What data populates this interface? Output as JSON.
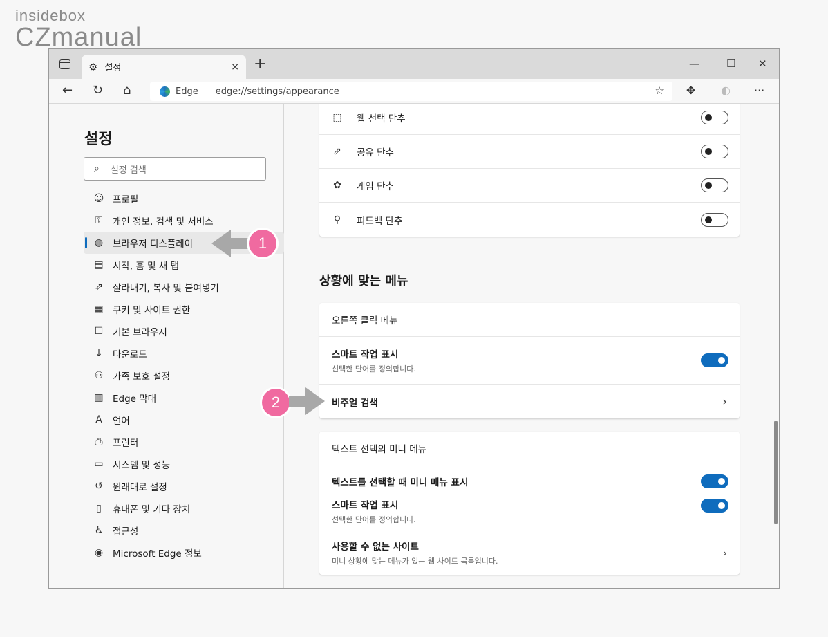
{
  "watermark": {
    "line1": "insidebox",
    "line2": "CZmanual"
  },
  "tab": {
    "title": "설정",
    "close": "×"
  },
  "toolbar": {
    "new_tab": "+",
    "minimize": "—",
    "maximize": "☐",
    "close": "✕",
    "back": "←",
    "refresh": "↻",
    "home": "⌂"
  },
  "address": {
    "brand": "Edge",
    "url": "edge://settings/appearance"
  },
  "sidebar": {
    "title": "설정",
    "search_placeholder": "설정 검색",
    "items": [
      {
        "label": "프로필",
        "icon": "profile-icon"
      },
      {
        "label": "개인 정보, 검색 및 서비스",
        "icon": "lock-icon"
      },
      {
        "label": "브라우저 디스플레이",
        "icon": "palette-icon",
        "active": true
      },
      {
        "label": "시작, 홈 및 새 탭",
        "icon": "start-icon"
      },
      {
        "label": "잘라내기, 복사 및 붙여넣기",
        "icon": "share-icon"
      },
      {
        "label": "쿠키 및 사이트 권한",
        "icon": "cookie-icon"
      },
      {
        "label": "기본 브라우저",
        "icon": "browser-icon"
      },
      {
        "label": "다운로드",
        "icon": "download-icon"
      },
      {
        "label": "가족 보호 설정",
        "icon": "family-icon"
      },
      {
        "label": "Edge 막대",
        "icon": "bar-icon"
      },
      {
        "label": "언어",
        "icon": "language-icon"
      },
      {
        "label": "프린터",
        "icon": "printer-icon"
      },
      {
        "label": "시스템 및 성능",
        "icon": "laptop-icon"
      },
      {
        "label": "원래대로 설정",
        "icon": "reset-icon"
      },
      {
        "label": "휴대폰 및 기타 장치",
        "icon": "phone-icon"
      },
      {
        "label": "접근성",
        "icon": "accessibility-icon"
      },
      {
        "label": "Microsoft Edge 정보",
        "icon": "edge-icon"
      }
    ]
  },
  "toolbar_buttons_card": {
    "rows": [
      {
        "label": "웹 선택 단추",
        "icon": "web-select-icon",
        "on": false
      },
      {
        "label": "공유 단추",
        "icon": "share-icon",
        "on": false
      },
      {
        "label": "게임 단추",
        "icon": "game-icon",
        "on": false
      },
      {
        "label": "피드백 단추",
        "icon": "feedback-icon",
        "on": false
      }
    ]
  },
  "context_menu": {
    "section_title": "상황에 맞는 메뉴",
    "right_click": {
      "header": "오른쪽 클릭 메뉴",
      "smart_action_label": "스마트 작업 표시",
      "smart_action_desc": "선택한 단어를 정의합니다.",
      "smart_action_on": true,
      "visual_search": "비주얼 검색"
    },
    "mini_menu": {
      "header": "텍스트 선택의 미니 메뉴",
      "show_label": "텍스트를 선택할 때 미니 메뉴 표시",
      "show_on": true,
      "smart_action_label": "스마트 작업 표시",
      "smart_action_desc": "선택한 단어를 정의합니다.",
      "smart_action_on": true,
      "blocked_label": "사용할 수 없는 사이트",
      "blocked_desc": "미니 상황에 맞는 메뉴가 있는 웹 사이트 목록입니다."
    }
  },
  "annotations": {
    "badge1": "1",
    "badge2": "2"
  }
}
